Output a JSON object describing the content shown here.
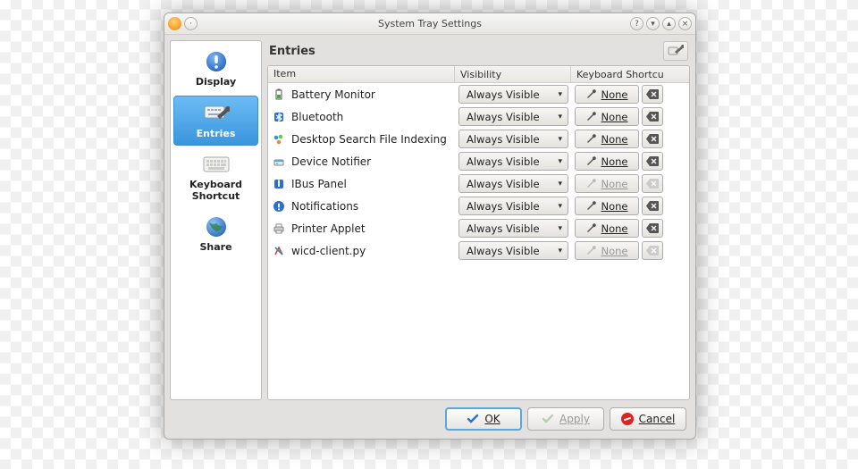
{
  "window": {
    "title": "System Tray Settings"
  },
  "sidebar": {
    "items": [
      {
        "label": "Display",
        "selected": false
      },
      {
        "label": "Entries",
        "selected": true
      },
      {
        "label": "Keyboard Shortcut",
        "selected": false
      },
      {
        "label": "Share",
        "selected": false
      }
    ]
  },
  "main": {
    "section_title": "Entries",
    "columns": {
      "item": "Item",
      "visibility": "Visibility",
      "shortcut": "Keyboard Shortcu"
    },
    "visibility_option": "Always Visible",
    "shortcut_none": "None",
    "rows": [
      {
        "icon": "battery",
        "name": "Battery Monitor",
        "shortcut_enabled": true
      },
      {
        "icon": "bluetooth",
        "name": "Bluetooth",
        "shortcut_enabled": true
      },
      {
        "icon": "search",
        "name": "Desktop Search File Indexing",
        "shortcut_enabled": true
      },
      {
        "icon": "device",
        "name": "Device Notifier",
        "shortcut_enabled": true
      },
      {
        "icon": "ibus",
        "name": "IBus Panel",
        "shortcut_enabled": false
      },
      {
        "icon": "notify",
        "name": "Notifications",
        "shortcut_enabled": true
      },
      {
        "icon": "printer",
        "name": "Printer Applet",
        "shortcut_enabled": true
      },
      {
        "icon": "wicd",
        "name": "wicd-client.py",
        "shortcut_enabled": false
      }
    ]
  },
  "footer": {
    "ok": "OK",
    "apply": "Apply",
    "cancel": "Cancel"
  }
}
